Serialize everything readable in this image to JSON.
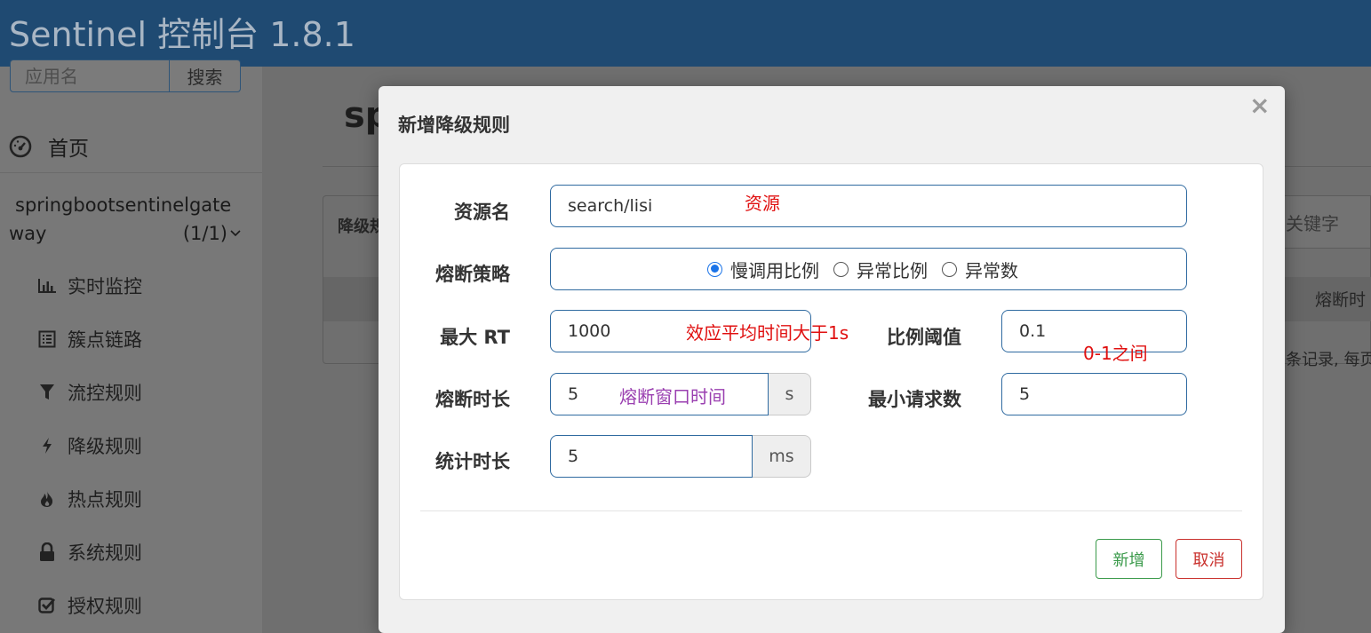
{
  "app": {
    "title": "Sentinel 控制台 1.8.1"
  },
  "sidebar": {
    "search_placeholder": "应用名",
    "search_button": "搜索",
    "home_label": "首页",
    "app_name_line1": "springbootsentinelgate",
    "app_name_line2": "way",
    "app_count": "(1/1)",
    "menu": [
      {
        "label": "实时监控",
        "icon": "bar-chart-icon"
      },
      {
        "label": "簇点链路",
        "icon": "list-icon"
      },
      {
        "label": "流控规则",
        "icon": "filter-icon"
      },
      {
        "label": "降级规则",
        "icon": "bolt-icon"
      },
      {
        "label": "热点规则",
        "icon": "fire-icon"
      },
      {
        "label": "系统规则",
        "icon": "lock-icon"
      },
      {
        "label": "授权规则",
        "icon": "check-square-icon"
      }
    ]
  },
  "main": {
    "page_title_partial": "sp",
    "panel_title_partial": "降级规",
    "keyword_placeholder": "关键字",
    "column_header_partial": "熔断时",
    "records_text_partial": "条记录, 每页"
  },
  "modal": {
    "title": "新增降级规则",
    "close_symbol": "×",
    "fields": {
      "resource": {
        "label": "资源名",
        "value": "search/lisi",
        "annotation": "资源"
      },
      "strategy": {
        "label": "熔断策略",
        "options": [
          "慢调用比例",
          "异常比例",
          "异常数"
        ],
        "selected": "慢调用比例"
      },
      "max_rt": {
        "label": "最大 RT",
        "value": "1000",
        "annotation": "效应平均时间大于1s"
      },
      "ratio_threshold": {
        "label": "比例阈值",
        "value": "0.1",
        "annotation": "0-1之间"
      },
      "circuit_duration": {
        "label": "熔断时长",
        "value": "5",
        "unit": "s",
        "annotation": "熔断窗口时间"
      },
      "min_requests": {
        "label": "最小请求数",
        "value": "5"
      },
      "stat_duration": {
        "label": "统计时长",
        "value": "5",
        "unit": "ms"
      }
    },
    "buttons": {
      "add": "新增",
      "cancel": "取消"
    }
  },
  "colors": {
    "header_bg": "#1f4a72",
    "annotation_red": "#e01010",
    "annotation_purple": "#9a3fb0",
    "input_border": "#2f6aa0",
    "btn_add": "#3a9a4a",
    "btn_cancel": "#c9302c",
    "radio_checked": "#1a73e8"
  }
}
